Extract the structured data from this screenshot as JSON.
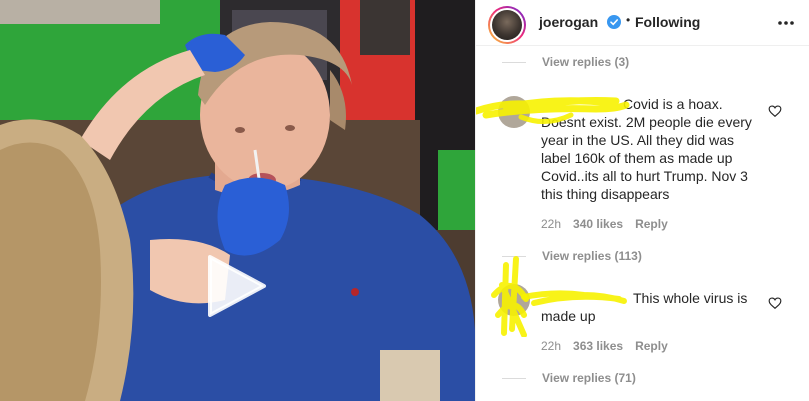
{
  "post": {
    "username": "joerogan",
    "separator": "•",
    "follow_state": "Following"
  },
  "comments": [
    {
      "view_replies": "View replies (3)"
    },
    {
      "visible_text": "Covid is a hoax. Doesnt exist. 2M people die every year in the US. All they did was label 160k of them as made up Covid..its all to hurt Trump. Nov 3 this thing disappears",
      "time": "22h",
      "likes": "340 likes",
      "reply": "Reply",
      "view_replies": "View replies (113)"
    },
    {
      "visible_text": "This whole virus is made up",
      "time": "22h",
      "likes": "363 likes",
      "reply": "Reply",
      "view_replies": "View replies (71)"
    }
  ],
  "colors": {
    "accent_blue": "#3897f0",
    "muted": "#8e8e8e",
    "scribble_yellow": "#f7f200"
  },
  "icons": [
    "verified-badge-icon",
    "more-options-icon",
    "heart-icon",
    "play-icon"
  ]
}
